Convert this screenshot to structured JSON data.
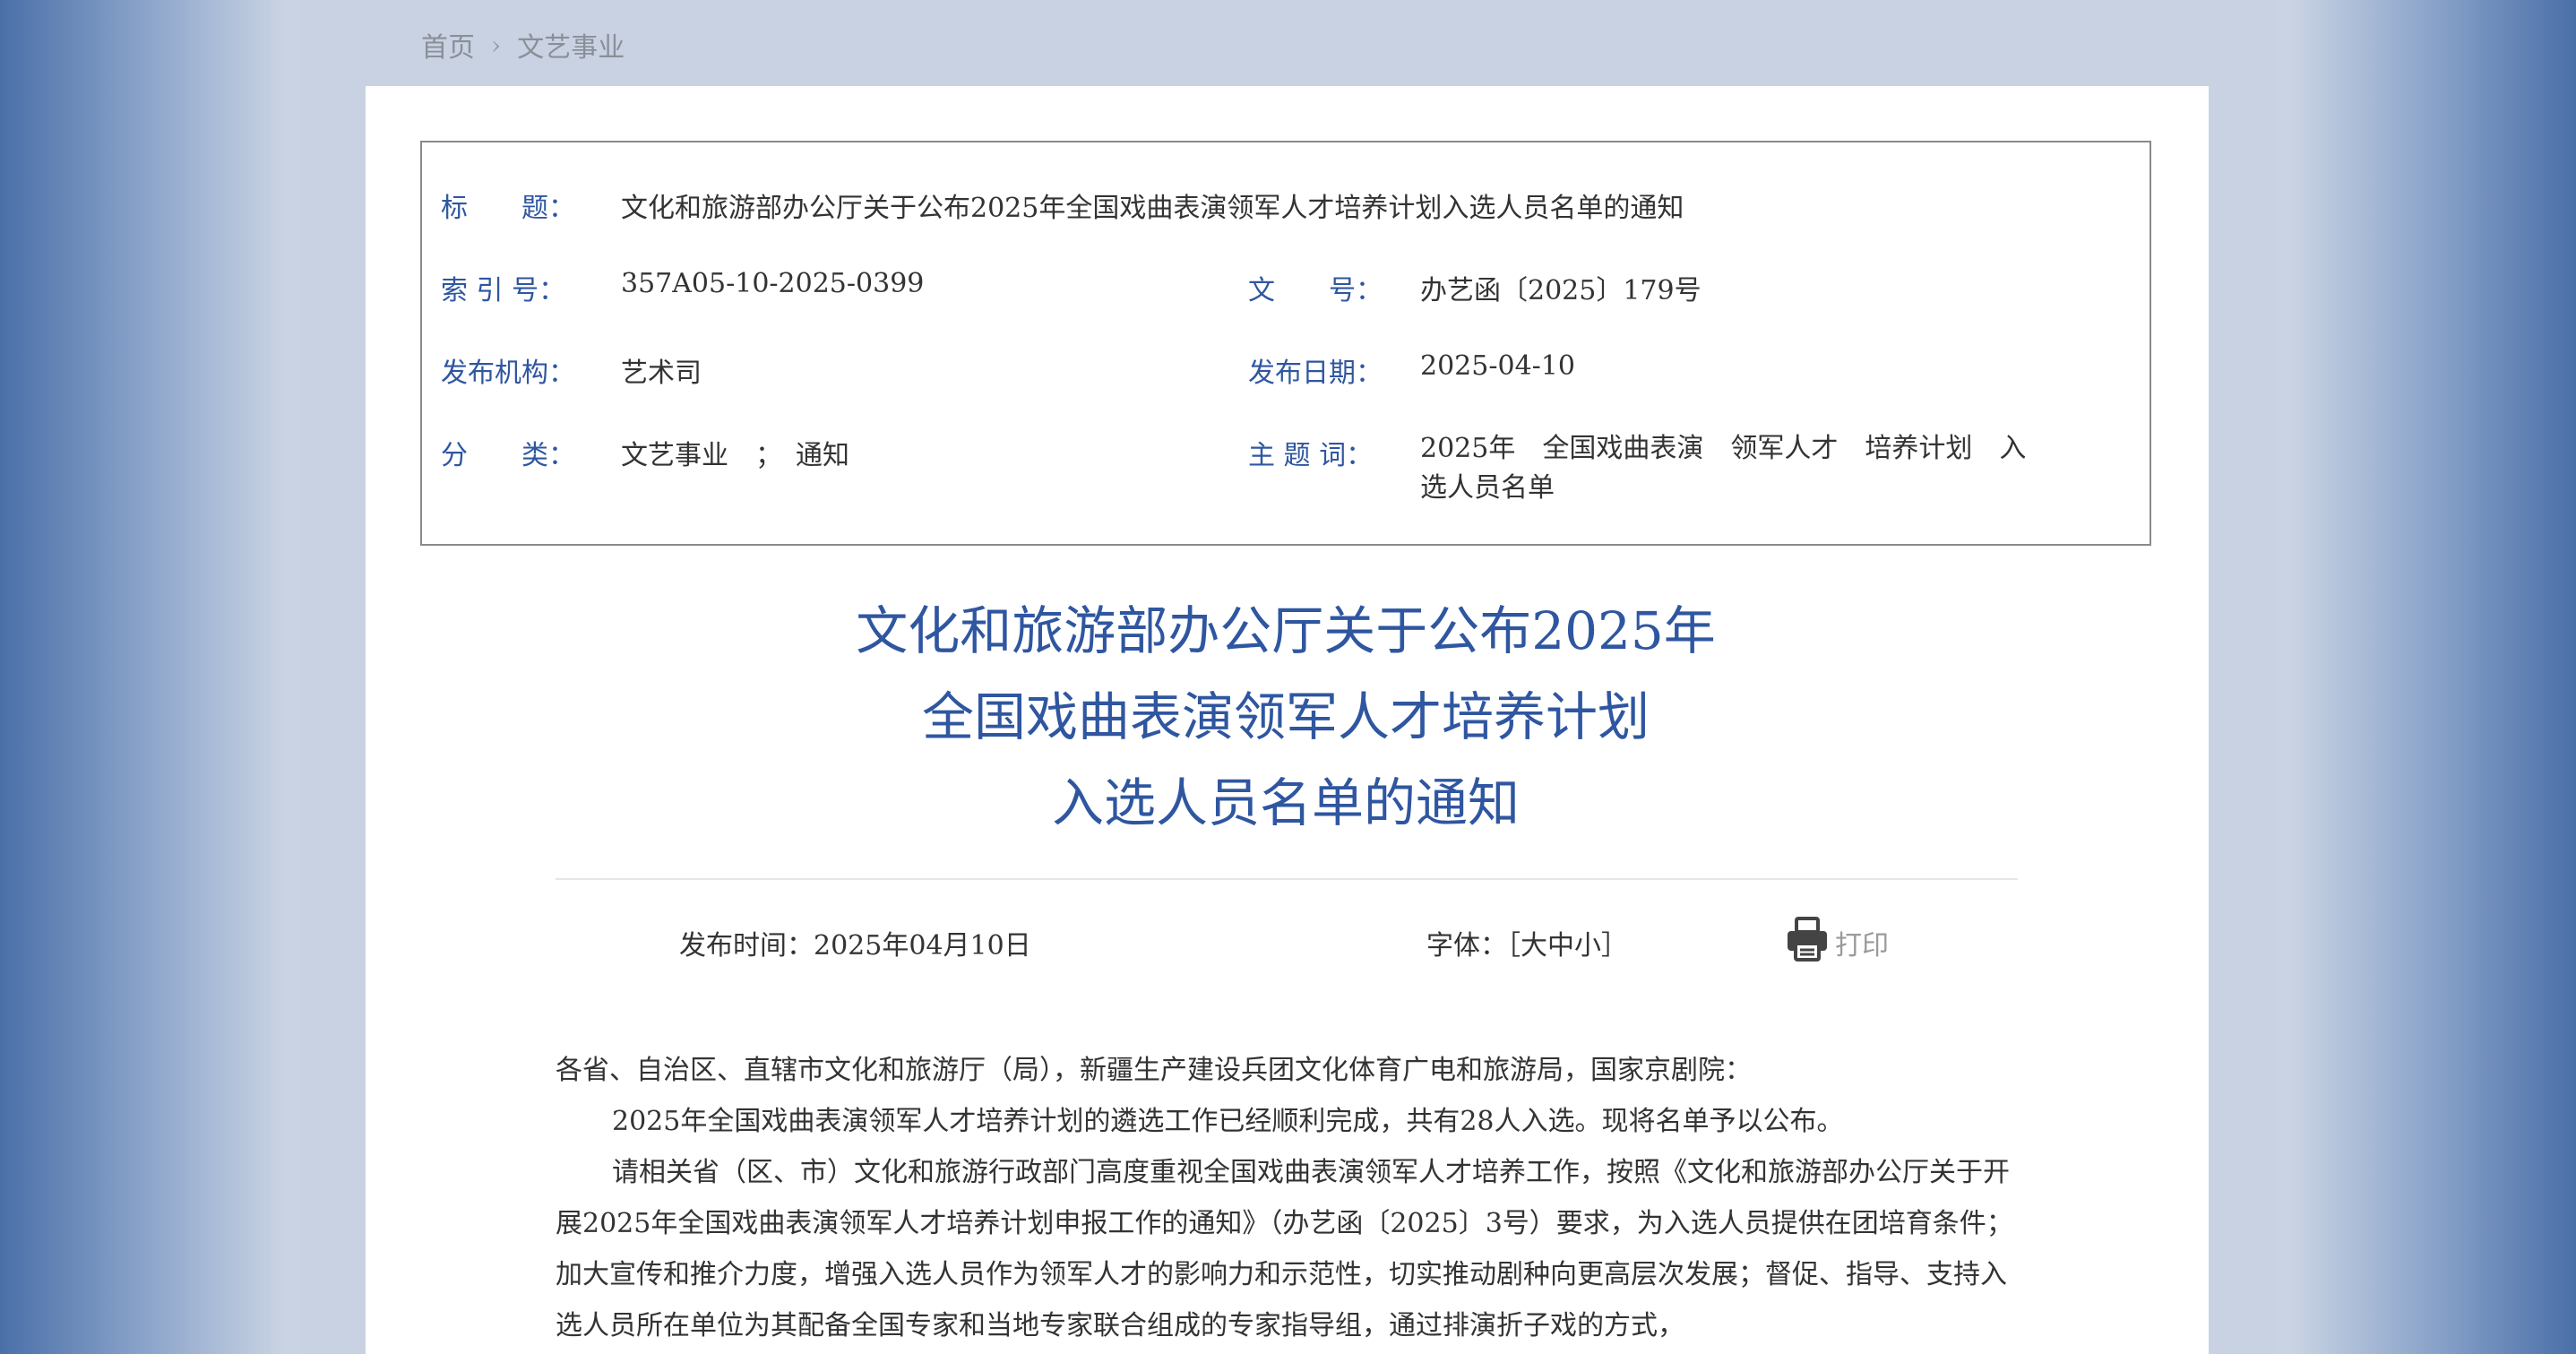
{
  "breadcrumb": {
    "home": "首页",
    "separator": "›",
    "current": "文艺事业"
  },
  "meta": {
    "title_label": "标　　题：",
    "title_value": "文化和旅游部办公厅关于公布2025年全国戏曲表演领军人才培养计划入选人员名单的通知",
    "index_label": "索 引 号：",
    "index_value": "357A05-10-2025-0399",
    "docno_label": "文　　号：",
    "docno_value": "办艺函〔2025〕179号",
    "agency_label": "发布机构：",
    "agency_value": "艺术司",
    "date_label": "发布日期：",
    "date_value": "2025-04-10",
    "category_label": "分　　类：",
    "category_value": "文艺事业　；　通知",
    "keywords_label": "主 题 词：",
    "keywords_value": "2025年　全国戏曲表演　领军人才　培养计划　入选人员名单"
  },
  "doc_title": {
    "line1": "文化和旅游部办公厅关于公布2025年",
    "line2": "全国戏曲表演领军人才培养计划",
    "line3": "入选人员名单的通知"
  },
  "info": {
    "publish_time": "发布时间：2025年04月10日",
    "font_label": "字体：",
    "font_open": "［",
    "font_large": "大",
    "font_medium": "中",
    "font_small": "小",
    "font_close": "］",
    "print_label": "打印"
  },
  "body": {
    "p1": "各省、自治区、直辖市文化和旅游厅（局），新疆生产建设兵团文化体育广电和旅游局，国家京剧院：",
    "p2": "2025年全国戏曲表演领军人才培养计划的遴选工作已经顺利完成，共有28人入选。现将名单予以公布。",
    "p3": "请相关省（区、市）文化和旅游行政部门高度重视全国戏曲表演领军人才培养工作，按照《文化和旅游部办公厅关于开展2025年全国戏曲表演领军人才培养计划申报工作的通知》（办艺函〔2025〕3号）要求，为入选人员提供在团培育条件；加大宣传和推介力度，增强入选人员作为领军人才的影响力和示范性，切实推动剧种向更高层次发展；督促、指导、支持入选人员所在单位为其配备全国专家和当地专家联合组成的专家指导组，通过排演折子戏的方式，"
  },
  "colors": {
    "accent": "#2f56a0",
    "text": "#333333",
    "muted": "#8a8f98"
  }
}
